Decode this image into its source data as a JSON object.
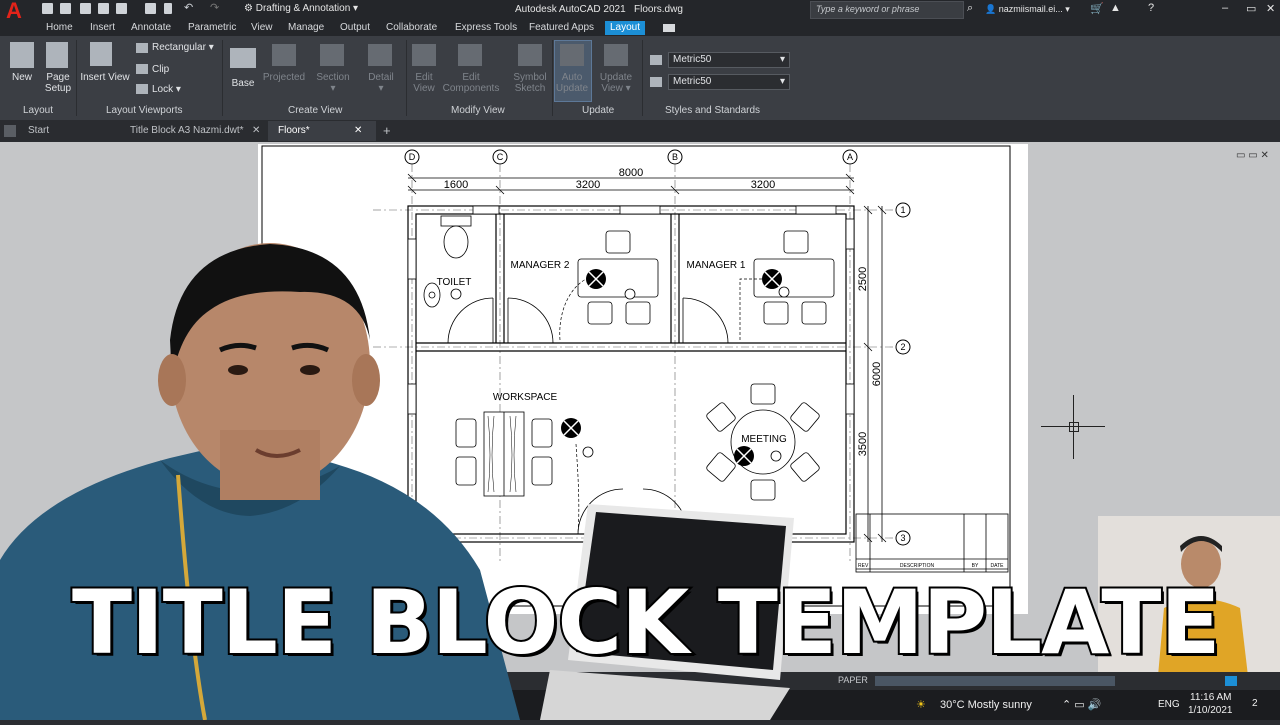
{
  "app": {
    "title": "Autodesk AutoCAD 2021",
    "file": "Floors.dwg",
    "workspace": "Drafting & Annotation",
    "search_placeholder": "Type a keyword or phrase",
    "user": "nazmiismail.ei..."
  },
  "ribbon_tabs": [
    "Home",
    "Insert",
    "Annotate",
    "Parametric",
    "View",
    "Manage",
    "Output",
    "Collaborate",
    "Express Tools",
    "Featured Apps",
    "Layout"
  ],
  "ribbon": {
    "layout": {
      "new": "New",
      "page_setup_1": "Page",
      "page_setup_2": "Setup",
      "label": "Layout"
    },
    "layout_viewports": {
      "insert_view": "Insert View",
      "rectangular": "Rectangular",
      "clip": "Clip",
      "lock": "Lock",
      "label": "Layout Viewports"
    },
    "create_view": {
      "base": "Base",
      "projected": "Projected",
      "section": "Section",
      "detail": "Detail",
      "label": "Create View"
    },
    "modify_view": {
      "edit_view_1": "Edit",
      "edit_view_2": "View",
      "edit_components_1": "Edit",
      "edit_components_2": "Components",
      "symbol_sketch_1": "Symbol",
      "symbol_sketch_2": "Sketch",
      "label": "Modify View"
    },
    "update": {
      "auto_update_1": "Auto",
      "auto_update_2": "Update",
      "update_view_1": "Update",
      "update_view_2": "View",
      "label": "Update"
    },
    "styles": {
      "style1": "Metric50",
      "style2": "Metric50",
      "label": "Styles and Standards"
    }
  },
  "doc_tabs": [
    "Start",
    "Title Block A3 Nazmi.dwt*",
    "Floors*"
  ],
  "drawing": {
    "grid_cols": [
      "D",
      "C",
      "B",
      "A"
    ],
    "grid_rows": [
      "1",
      "2",
      "3"
    ],
    "dims_top": {
      "overall": "8000",
      "d1": "1600",
      "d2": "3200",
      "d3": "3200"
    },
    "dims_right": {
      "overall": "6000",
      "d1": "2500",
      "d2": "3500"
    },
    "rooms": {
      "toilet": "TOILET",
      "manager2": "MANAGER 2",
      "manager1": "MANAGER 1",
      "workspace": "WORKSPACE",
      "meeting": "MEETING"
    },
    "title_block": {
      "rev": "REV",
      "description": "DESCRIPTION",
      "by": "BY",
      "date": "DATE"
    }
  },
  "status": {
    "paper": "PAPER"
  },
  "taskbar": {
    "weather": "30°C  Mostly sunny",
    "lang": "ENG",
    "time": "11:16 AM",
    "date": "1/10/2021",
    "notif": "2"
  },
  "overlay": {
    "caption": "TITLE BLOCK TEMPLATE"
  },
  "colors": {
    "accent": "#1c8fd6",
    "logo": "#e2231a",
    "ribbon_bg": "#3b3e44"
  }
}
